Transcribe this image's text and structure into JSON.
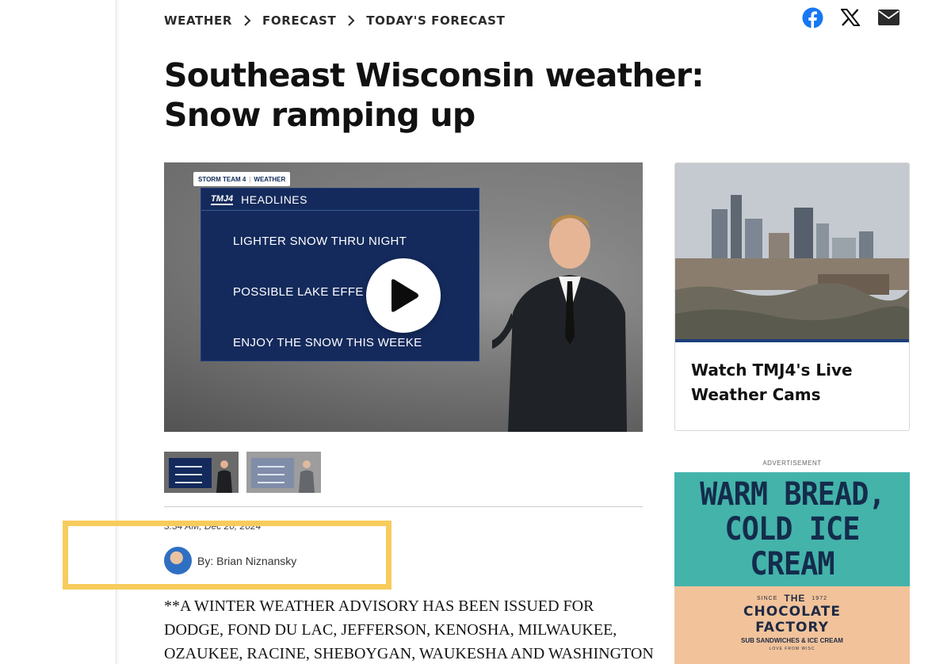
{
  "breadcrumb": [
    "WEATHER",
    "FORECAST",
    "TODAY'S FORECAST"
  ],
  "share": {
    "icons": [
      "facebook-icon",
      "x-icon",
      "email-icon"
    ],
    "facebook_color": "#1877f2"
  },
  "article": {
    "title": "Southeast Wisconsin weather: Snow ramping up",
    "timestamp": "3:34 AM, Dec 20, 2024",
    "author": "By: Brian Niznansky",
    "body": "**A WINTER WEATHER ADVISORY HAS BEEN ISSUED FOR DODGE, FOND DU LAC, JEFFERSON, KENOSHA, MILWAUKEE, OZAUKEE, RACINE, SHEBOYGAN, WAUKESHA AND WASHINGTON"
  },
  "video": {
    "tag": [
      "STORM TEAM 4",
      "WEATHER"
    ],
    "logo": "TMJ4",
    "panel_title": "HEADLINES",
    "lines": [
      "LIGHTER SNOW THRU NIGHT",
      "POSSIBLE LAKE EFFE",
      "ENJOY THE SNOW THIS WEEKE"
    ],
    "play_icon": "play-icon",
    "thumbnail_count": 2
  },
  "promo": {
    "title": "Watch TMJ4's Live Weather Cams"
  },
  "ad": {
    "label": "ADVERTISEMENT",
    "headline_line1": "WARM BREAD,",
    "headline_line2": "COLD ICE CREAM",
    "since": "SINCE",
    "year": "1972",
    "the": "THE",
    "brand_line1": "CHOCOLATE",
    "brand_line2": "FACTORY",
    "tagline": "SUB SANDWICHES & ICE CREAM",
    "small": "LOVE FROM WISC",
    "colors": {
      "teal": "#44b3aa",
      "peach": "#f2c39a",
      "navy": "#142c4c"
    }
  },
  "highlight_color": "#f7cc5c"
}
